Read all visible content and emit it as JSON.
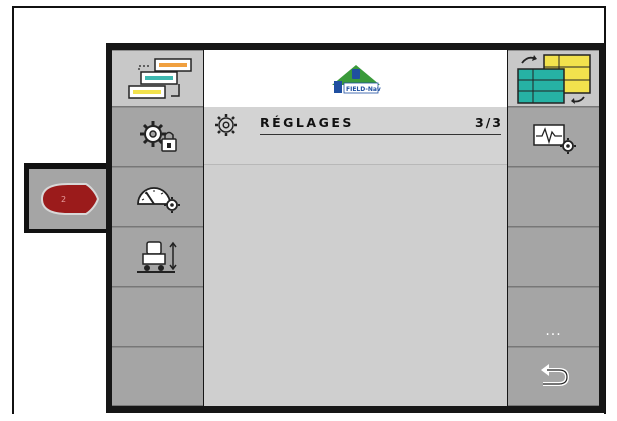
{
  "header": {
    "logo_text": "FIELD-Nav"
  },
  "menu": {
    "title": "RÉGLAGES",
    "page": "3/3"
  },
  "side_tab": {
    "badge": "2"
  },
  "right_column": {
    "more_label": "..."
  },
  "left_column": {
    "items": [
      {
        "icon": "layout-stack-icon"
      },
      {
        "icon": "gear-lock-icon"
      },
      {
        "icon": "speedometer-gear-icon"
      },
      {
        "icon": "implement-height-icon"
      },
      {
        "icon": ""
      },
      {
        "icon": ""
      }
    ]
  },
  "colors": {
    "accent_red": "#9b1b1b",
    "brand_blue": "#1f4fa0",
    "brand_green": "#3a9a3a",
    "panel_gray": "#a5a5a5"
  }
}
